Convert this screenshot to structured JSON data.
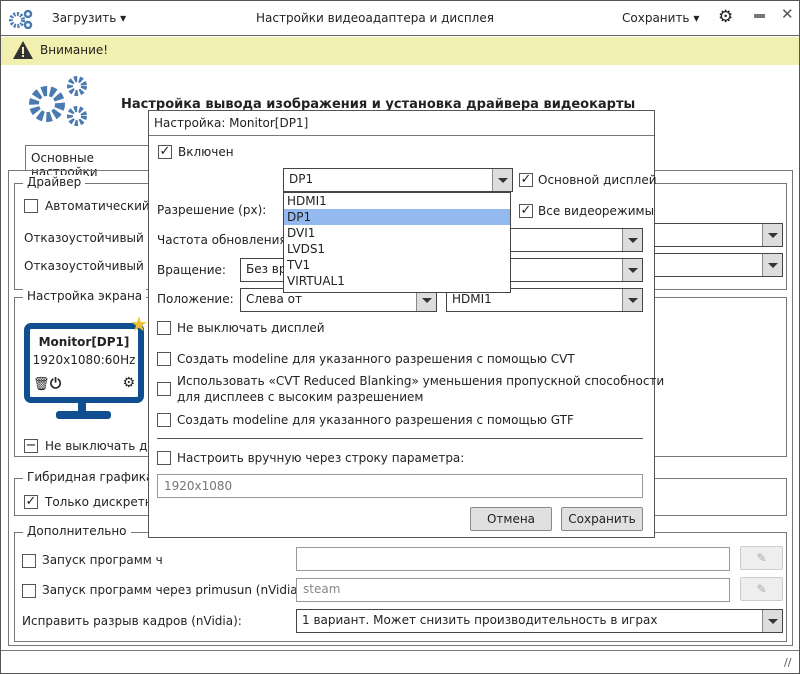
{
  "titlebar": {
    "load_label": "Загрузить",
    "title": "Настройки видеоадаптера и дисплея",
    "save_label": "Сохранить"
  },
  "warning": {
    "text": "Внимание!"
  },
  "header": {
    "title": "Настройка вывода изображения и установка драйвера видеокарты"
  },
  "tabs": [
    {
      "label": "Основные настройки"
    }
  ],
  "driver": {
    "group_label": "Драйвер",
    "auto_label": "Автоматический в",
    "failsafe1": "Отказоустойчивый др",
    "failsafe2": "Отказоустойчивый др"
  },
  "screen": {
    "group_label": "Настройка экрана",
    "monitor_name": "Monitor[DP1]",
    "monitor_mode": "1920x1080:60Hz",
    "keep_on_label": "Не выключать ди"
  },
  "hybrid": {
    "group_label": "Гибридная графика",
    "discrete_label": "Только дискретно"
  },
  "extra": {
    "group_label": "Дополнительно",
    "run1_label": "Запуск программ ч",
    "run2_label": "Запуск программ через primusun (nVidia):",
    "run2_value": "steam",
    "tearing_label": "Исправить разрыв кадров (nVidia):",
    "tearing_value": "1 вариант. Может снизить производительность в играх"
  },
  "dialog": {
    "title": "Настройка: Monitor[DP1]",
    "enabled_label": "Включен",
    "output_value": "DP1",
    "output_options": [
      "HDMI1",
      "DP1",
      "DVI1",
      "LVDS1",
      "TV1",
      "VIRTUAL1"
    ],
    "primary_label": "Основной дисплей",
    "all_modes_label": "Все видеорежимы",
    "resolution_label": "Разрешение (px):",
    "refresh_label": "Частота обновления (",
    "rotation_label": "Вращение:",
    "rotation_value": "Без вр",
    "position_label": "Положение:",
    "position_value": "Слева от",
    "position_target": "HDMI1",
    "keep_on_label": "Не выключать дисплей",
    "cvt_label": "Создать modeline для указанного разрешения с помощью CVT",
    "cvt_rb_label1": "Использовать «CVT Reduced Blanking» уменьшения пропускной способности",
    "cvt_rb_label2": "для дисплеев с высоким разрешением",
    "gtf_label": "Создать modeline для указанного разрешения с помощью GTF",
    "manual_label": "Настроить вручную через строку параметра:",
    "manual_placeholder": "1920x1080",
    "cancel_label": "Отмена",
    "save_label": "Сохранить"
  },
  "colors": {
    "accent": "#4a7ab0",
    "monitor": "#0f4f8f",
    "warning_bg": "#f2f0b0",
    "selection": "#93b9ee",
    "star": "#f0c030"
  }
}
